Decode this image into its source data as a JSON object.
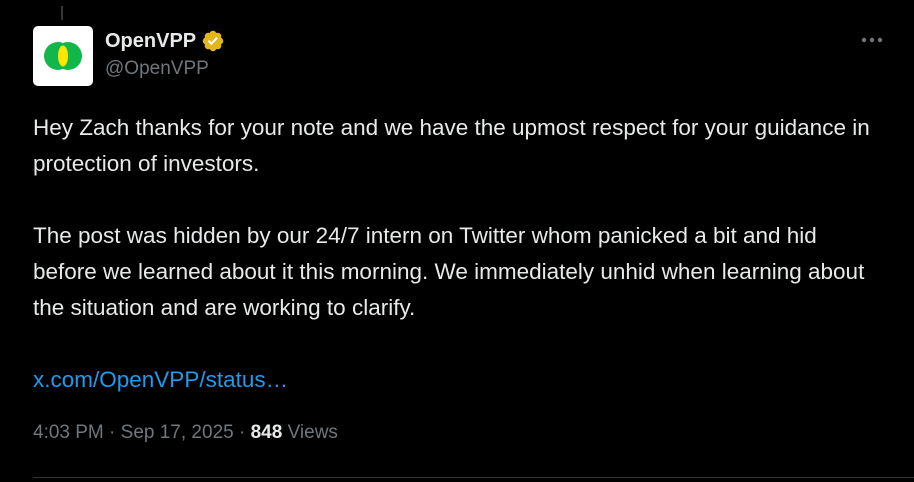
{
  "author": {
    "display_name": "OpenVPP",
    "handle": "@OpenVPP",
    "verified_badge": "gold-verified-badge-icon",
    "avatar": "openvpp-logo"
  },
  "tweet": {
    "paragraph_1": "Hey Zach thanks for your note and we have the upmost respect for your guidance in protection of investors.",
    "paragraph_2": "The post was hidden by our 24/7 intern on Twitter whom panicked a bit and hid before we learned about it this morning.  We immediately unhid when learning about the situation and are working  to clarify.",
    "link": "x.com/OpenVPP/status…"
  },
  "meta": {
    "time": "4:03 PM",
    "separator_1": " · ",
    "date": "Sep 17, 2025",
    "separator_2": " · ",
    "views_count": "848",
    "views_label": " Views"
  },
  "icons": {
    "more": "more-options-icon"
  },
  "colors": {
    "background": "#000000",
    "text": "#e7e9ea",
    "secondary_text": "#71767b",
    "link": "#1d9bf0",
    "verified_gold": "#e2b719",
    "logo_green": "#12b64a"
  }
}
